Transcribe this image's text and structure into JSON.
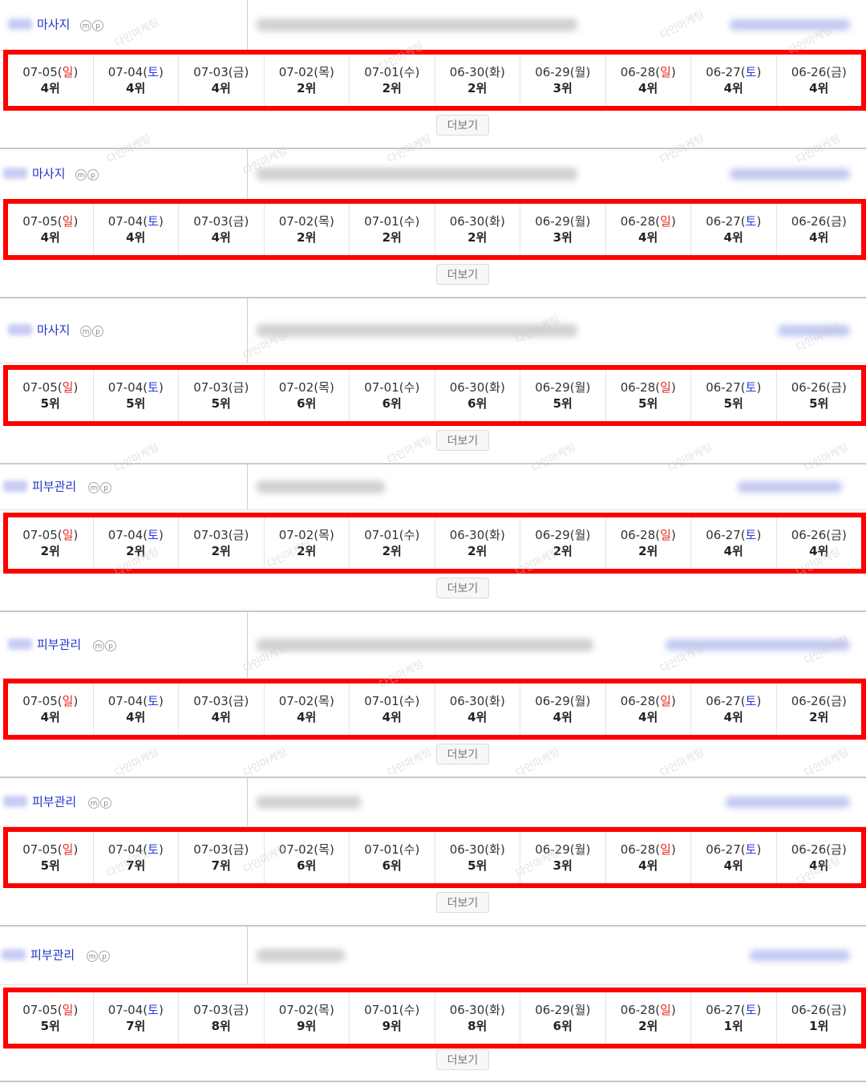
{
  "more_label": "더보기",
  "mp_icons": {
    "m": "m",
    "p": "p"
  },
  "weekday_colors": {
    "sun": "#e8261f",
    "sat": "#2a3ad8",
    "weekday": "#333333"
  },
  "highlight_color": "#ff0000",
  "watermark_text": "다인마케팅",
  "rows": [
    {
      "keyword": "마사지",
      "cells": [
        {
          "date": "07-05",
          "day": "일",
          "rank": "4위"
        },
        {
          "date": "07-04",
          "day": "토",
          "rank": "4위"
        },
        {
          "date": "07-03",
          "day": "금",
          "rank": "4위"
        },
        {
          "date": "07-02",
          "day": "목",
          "rank": "2위"
        },
        {
          "date": "07-01",
          "day": "수",
          "rank": "2위"
        },
        {
          "date": "06-30",
          "day": "화",
          "rank": "2위"
        },
        {
          "date": "06-29",
          "day": "월",
          "rank": "3위"
        },
        {
          "date": "06-28",
          "day": "일",
          "rank": "4위"
        },
        {
          "date": "06-27",
          "day": "토",
          "rank": "4위"
        },
        {
          "date": "06-26",
          "day": "금",
          "rank": "4위"
        }
      ]
    },
    {
      "keyword": "마사지",
      "cells": [
        {
          "date": "07-05",
          "day": "일",
          "rank": "4위"
        },
        {
          "date": "07-04",
          "day": "토",
          "rank": "4위"
        },
        {
          "date": "07-03",
          "day": "금",
          "rank": "4위"
        },
        {
          "date": "07-02",
          "day": "목",
          "rank": "2위"
        },
        {
          "date": "07-01",
          "day": "수",
          "rank": "2위"
        },
        {
          "date": "06-30",
          "day": "화",
          "rank": "2위"
        },
        {
          "date": "06-29",
          "day": "월",
          "rank": "3위"
        },
        {
          "date": "06-28",
          "day": "일",
          "rank": "4위"
        },
        {
          "date": "06-27",
          "day": "토",
          "rank": "4위"
        },
        {
          "date": "06-26",
          "day": "금",
          "rank": "4위"
        }
      ]
    },
    {
      "keyword": "마사지",
      "cells": [
        {
          "date": "07-05",
          "day": "일",
          "rank": "5위"
        },
        {
          "date": "07-04",
          "day": "토",
          "rank": "5위"
        },
        {
          "date": "07-03",
          "day": "금",
          "rank": "5위"
        },
        {
          "date": "07-02",
          "day": "목",
          "rank": "6위"
        },
        {
          "date": "07-01",
          "day": "수",
          "rank": "6위"
        },
        {
          "date": "06-30",
          "day": "화",
          "rank": "6위"
        },
        {
          "date": "06-29",
          "day": "월",
          "rank": "5위"
        },
        {
          "date": "06-28",
          "day": "일",
          "rank": "5위"
        },
        {
          "date": "06-27",
          "day": "토",
          "rank": "5위"
        },
        {
          "date": "06-26",
          "day": "금",
          "rank": "5위"
        }
      ]
    },
    {
      "keyword": "피부관리",
      "cells": [
        {
          "date": "07-05",
          "day": "일",
          "rank": "2위"
        },
        {
          "date": "07-04",
          "day": "토",
          "rank": "2위"
        },
        {
          "date": "07-03",
          "day": "금",
          "rank": "2위"
        },
        {
          "date": "07-02",
          "day": "목",
          "rank": "2위"
        },
        {
          "date": "07-01",
          "day": "수",
          "rank": "2위"
        },
        {
          "date": "06-30",
          "day": "화",
          "rank": "2위"
        },
        {
          "date": "06-29",
          "day": "월",
          "rank": "2위"
        },
        {
          "date": "06-28",
          "day": "일",
          "rank": "2위"
        },
        {
          "date": "06-27",
          "day": "토",
          "rank": "4위"
        },
        {
          "date": "06-26",
          "day": "금",
          "rank": "4위"
        }
      ]
    },
    {
      "keyword": "피부관리",
      "cells": [
        {
          "date": "07-05",
          "day": "일",
          "rank": "4위"
        },
        {
          "date": "07-04",
          "day": "토",
          "rank": "4위"
        },
        {
          "date": "07-03",
          "day": "금",
          "rank": "4위"
        },
        {
          "date": "07-02",
          "day": "목",
          "rank": "4위"
        },
        {
          "date": "07-01",
          "day": "수",
          "rank": "4위"
        },
        {
          "date": "06-30",
          "day": "화",
          "rank": "4위"
        },
        {
          "date": "06-29",
          "day": "월",
          "rank": "4위"
        },
        {
          "date": "06-28",
          "day": "일",
          "rank": "4위"
        },
        {
          "date": "06-27",
          "day": "토",
          "rank": "4위"
        },
        {
          "date": "06-26",
          "day": "금",
          "rank": "2위"
        }
      ]
    },
    {
      "keyword": "피부관리",
      "cells": [
        {
          "date": "07-05",
          "day": "일",
          "rank": "5위"
        },
        {
          "date": "07-04",
          "day": "토",
          "rank": "7위"
        },
        {
          "date": "07-03",
          "day": "금",
          "rank": "7위"
        },
        {
          "date": "07-02",
          "day": "목",
          "rank": "6위"
        },
        {
          "date": "07-01",
          "day": "수",
          "rank": "6위"
        },
        {
          "date": "06-30",
          "day": "화",
          "rank": "5위"
        },
        {
          "date": "06-29",
          "day": "월",
          "rank": "3위"
        },
        {
          "date": "06-28",
          "day": "일",
          "rank": "4위"
        },
        {
          "date": "06-27",
          "day": "토",
          "rank": "4위"
        },
        {
          "date": "06-26",
          "day": "금",
          "rank": "4위"
        }
      ]
    },
    {
      "keyword": "피부관리",
      "cells": [
        {
          "date": "07-05",
          "day": "일",
          "rank": "5위"
        },
        {
          "date": "07-04",
          "day": "토",
          "rank": "7위"
        },
        {
          "date": "07-03",
          "day": "금",
          "rank": "8위"
        },
        {
          "date": "07-02",
          "day": "목",
          "rank": "9위"
        },
        {
          "date": "07-01",
          "day": "수",
          "rank": "9위"
        },
        {
          "date": "06-30",
          "day": "화",
          "rank": "8위"
        },
        {
          "date": "06-29",
          "day": "월",
          "rank": "6위"
        },
        {
          "date": "06-28",
          "day": "일",
          "rank": "2위"
        },
        {
          "date": "06-27",
          "day": "토",
          "rank": "1위"
        },
        {
          "date": "06-26",
          "day": "금",
          "rank": "1위"
        }
      ]
    }
  ]
}
